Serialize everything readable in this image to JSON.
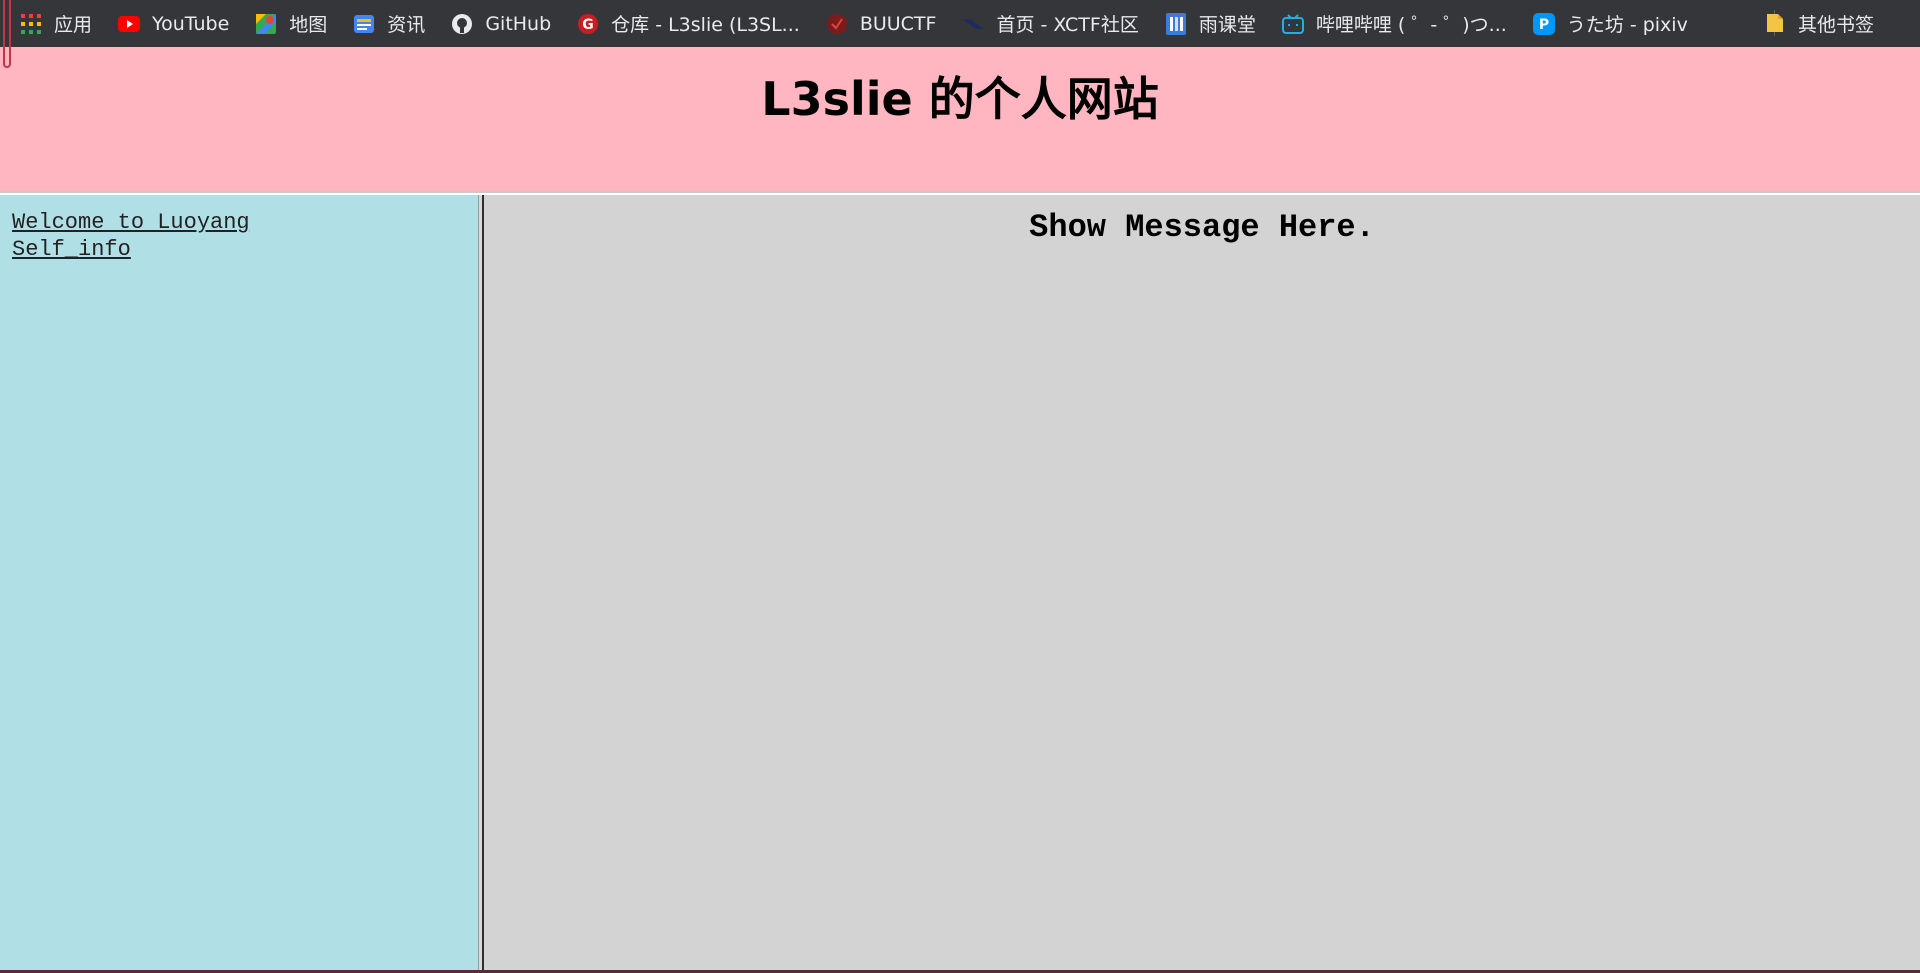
{
  "bookmarks_bar": {
    "items": [
      {
        "label": "应用",
        "icon": "apps-grid-icon"
      },
      {
        "label": "YouTube",
        "icon": "youtube-icon"
      },
      {
        "label": "地图",
        "icon": "maps-icon"
      },
      {
        "label": "资讯",
        "icon": "news-icon"
      },
      {
        "label": "GitHub",
        "icon": "github-icon"
      },
      {
        "label": "仓库 - L3slie (L3SL...",
        "icon": "gitee-icon"
      },
      {
        "label": "BUUCTF",
        "icon": "buuctf-icon"
      },
      {
        "label": "首页 - XCTF社区",
        "icon": "xctf-icon"
      },
      {
        "label": "雨课堂",
        "icon": "yuketang-icon"
      },
      {
        "label": "哔哩哔哩 ( ゜- ゜)つ...",
        "icon": "bilibili-icon"
      },
      {
        "label": "うた坊 - pixiv",
        "icon": "pixiv-icon"
      }
    ],
    "other_bookmarks": {
      "label": "其他书签",
      "icon": "folder-icon"
    }
  },
  "header": {
    "title": "L3slie 的个人网站"
  },
  "left_frame": {
    "links": [
      {
        "label": "Welcome to Luoyang"
      },
      {
        "label": "Self_info"
      }
    ]
  },
  "right_frame": {
    "message": "Show Message Here."
  },
  "colors": {
    "header_bg": "#ffb6c1",
    "left_bg": "#b0e0e6",
    "right_bg": "#d3d3d3",
    "bookmarks_bg": "#35363a"
  }
}
